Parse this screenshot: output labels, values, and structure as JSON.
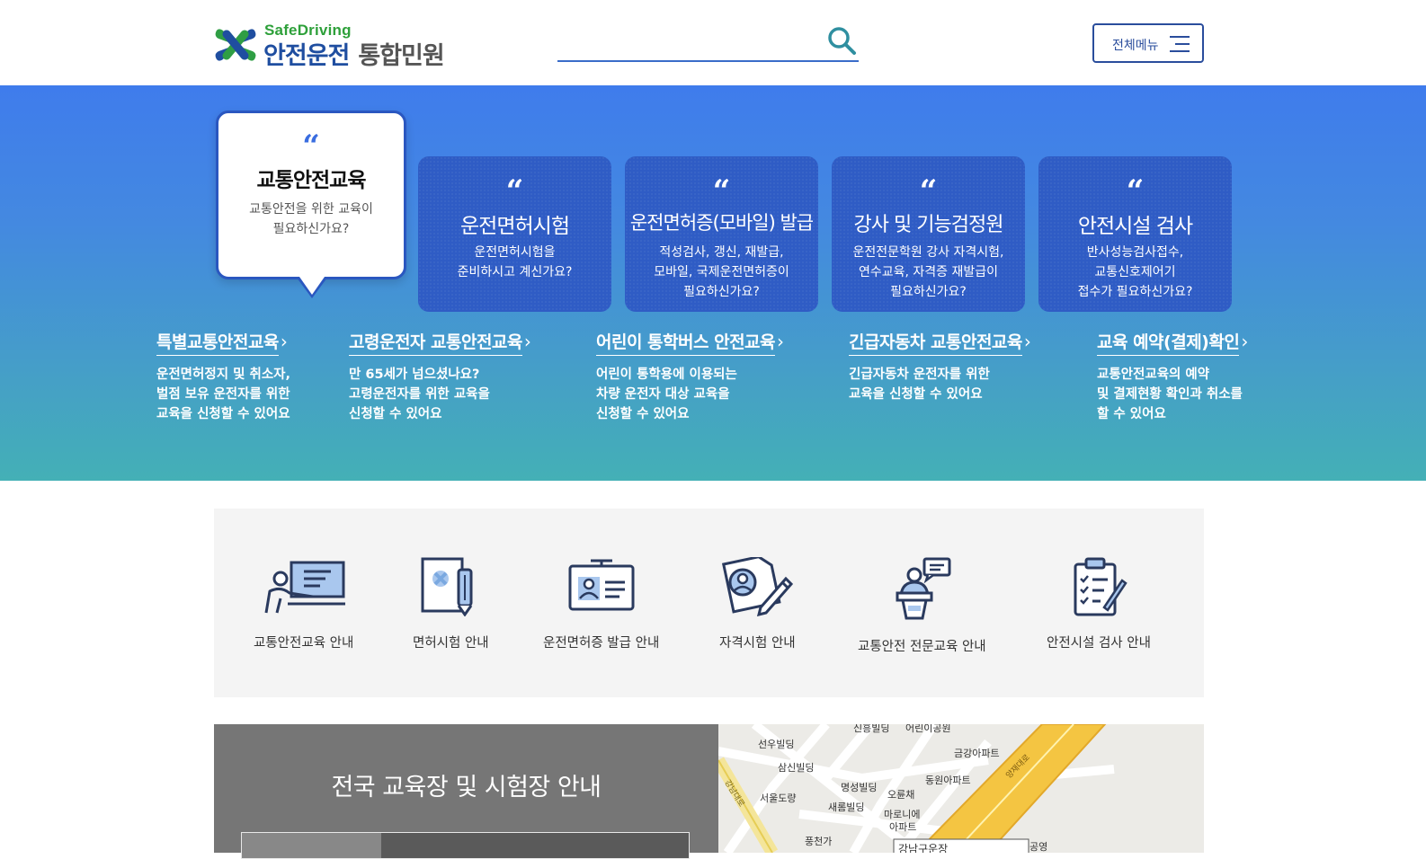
{
  "header": {
    "logo_sub": "SafeDriving",
    "logo_main": "안전운전",
    "logo_main2": "통합민원",
    "search_placeholder": "",
    "menu_label": "전체메뉴"
  },
  "colors": {
    "brand_blue": "#1f4ea0",
    "brand_green": "#2ea03a",
    "card_blue": "#2f5cc5"
  },
  "cards": [
    {
      "title": "교통안전교육",
      "desc": [
        "교통안전을 위한 교육이",
        "필요하신가요?"
      ],
      "active": true
    },
    {
      "title": "운전면허시험",
      "desc": [
        "운전면허시험을",
        "준비하시고 계신가요?"
      ]
    },
    {
      "title": "운전면허증(모바일) 발급",
      "desc": [
        "적성검사, 갱신, 재발급,",
        "모바일, 국제운전면허증이",
        "필요하신가요?"
      ]
    },
    {
      "title": "강사 및 기능검정원",
      "desc": [
        "운전전문학원 강사 자격시험,",
        "연수교육, 자격증 재발급이",
        "필요하신가요?"
      ]
    },
    {
      "title": "안전시설 검사",
      "desc": [
        "반사성능검사접수,",
        "교통신호제어기",
        "접수가 필요하신가요?"
      ]
    }
  ],
  "quote_mark": "“",
  "subs": [
    {
      "title": "특별교통안전교육",
      "desc": [
        "운전면허정지 및 취소자,",
        "벌점 보유 운전자를 위한",
        "교육을 신청할 수 있어요"
      ]
    },
    {
      "title": "고령운전자 교통안전교육",
      "desc": [
        "만 65세가 넘으셨나요?",
        "고령운전자를 위한 교육을",
        "신청할 수 있어요"
      ]
    },
    {
      "title": "어린이 통학버스 안전교육",
      "desc": [
        "어린이 통학용에 이용되는",
        "차량 운전자 대상 교육을",
        "신청할 수 있어요"
      ]
    },
    {
      "title": "긴급자동차 교통안전교육",
      "desc": [
        "긴급자동차 운전자를 위한",
        "교육을 신청할 수 있어요"
      ]
    },
    {
      "title": "교육 예약(결제)확인",
      "desc": [
        "교통안전교육의 예약",
        "및 결제현황 확인과 취소를",
        "할 수 있어요"
      ]
    }
  ],
  "chevron": "›",
  "guides": [
    {
      "label": "교통안전교육 안내",
      "icon": "lecture-icon"
    },
    {
      "label": "면허시험 안내",
      "icon": "license-exam-icon"
    },
    {
      "label": "운전면허증 발급 안내",
      "icon": "id-card-icon"
    },
    {
      "label": "자격시험 안내",
      "icon": "certificate-exam-icon"
    },
    {
      "label": "교통안전 전문교육 안내",
      "icon": "speaker-podium-icon"
    },
    {
      "label": "안전시설 검사 안내",
      "icon": "checklist-icon"
    }
  ],
  "bottom": {
    "title": "전국 교육장 및 시험장 안내"
  },
  "map_labels": [
    "신흥빌딩",
    "어린이공원",
    "선우빌딩",
    "금강아파트",
    "삼신빌딩",
    "명성빌딩",
    "동원아파트",
    "서울도량",
    "오륜채",
    "새롬빌딩",
    "마로니에",
    "아파트",
    "풍천가",
    "강남구운장",
    "공영",
    "강남대로",
    "양재대로"
  ]
}
